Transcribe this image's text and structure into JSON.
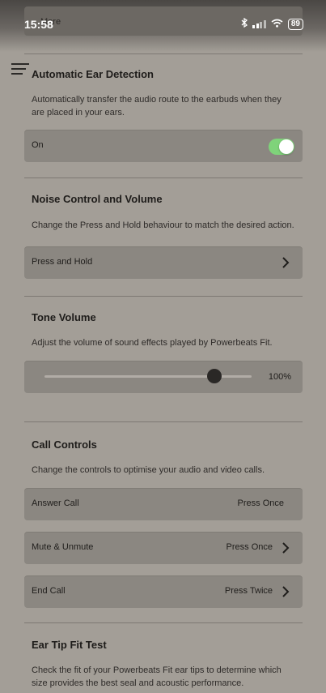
{
  "status_bar": {
    "time": "15:58",
    "battery": "89"
  },
  "top_card": {
    "label": "More"
  },
  "ear_detection": {
    "title": "Automatic Ear Detection",
    "description": "Automatically transfer the audio route to the earbuds when they are placed in your ears.",
    "toggle_label": "On",
    "toggle_on": true
  },
  "noise_control": {
    "title": "Noise Control and Volume",
    "description": "Change the Press and Hold behaviour to match the desired action.",
    "row_label": "Press and Hold"
  },
  "tone_volume": {
    "title": "Tone Volume",
    "description": "Adjust the volume of sound effects played by Powerbeats Fit.",
    "value_label": "100%",
    "slider_fraction": 0.82
  },
  "call_controls": {
    "title": "Call Controls",
    "description": "Change the controls to optimise your audio and video calls.",
    "rows": [
      {
        "label": "Answer Call",
        "value": "Press Once"
      },
      {
        "label": "Mute & Unmute",
        "value": "Press Once"
      },
      {
        "label": "End Call",
        "value": "Press Twice"
      }
    ]
  },
  "ear_tip": {
    "title": "Ear Tip Fit Test",
    "description": "Check the fit of your Powerbeats Fit ear tips to determine which size provides the best seal and acoustic performance."
  },
  "colors": {
    "background": "#a39e97",
    "row": "#8b8781",
    "toggle_on": "#7fd37a"
  }
}
